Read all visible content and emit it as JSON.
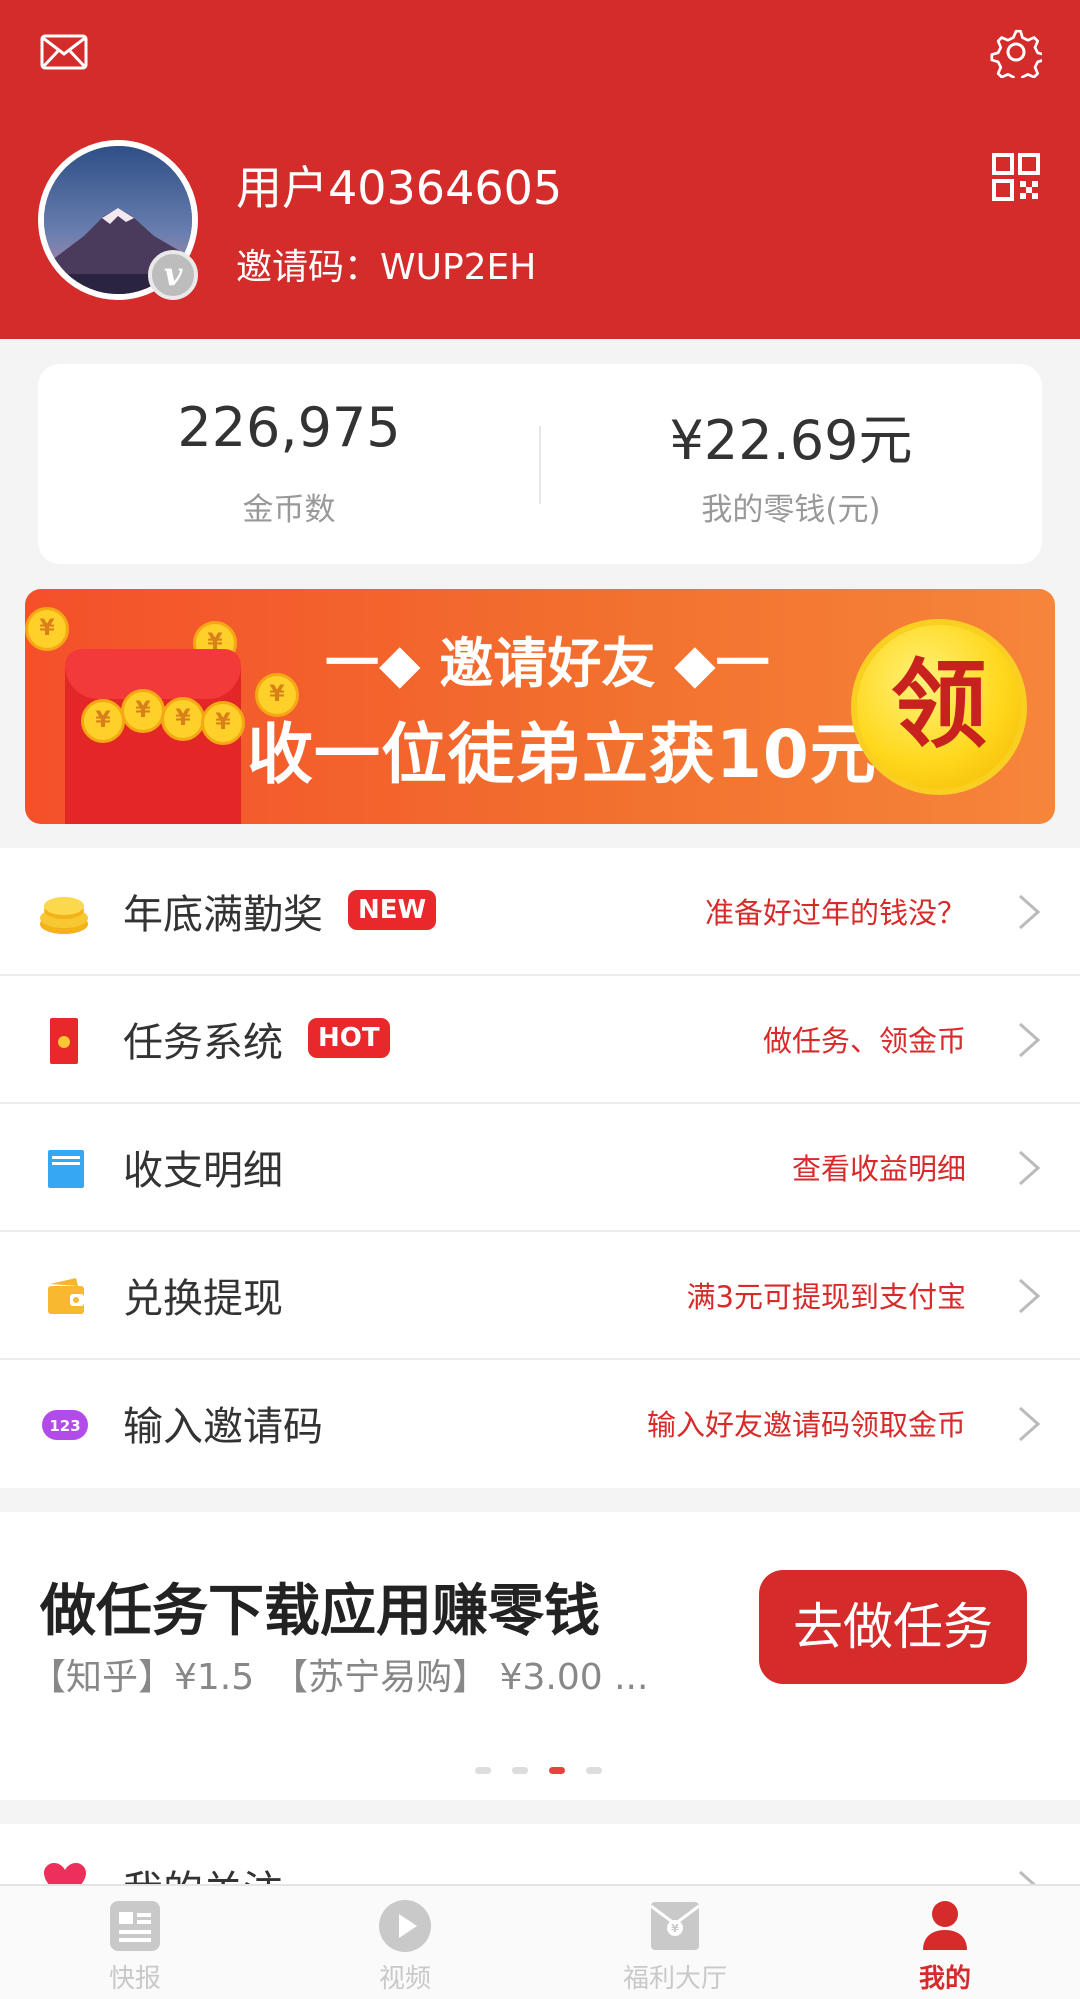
{
  "header": {
    "username": "用户40364605",
    "invite_code": "邀请码：WUP2EH",
    "icons": [
      "mail-icon",
      "settings-icon",
      "qr-code-icon"
    ],
    "avatar_badge": "v"
  },
  "stats": {
    "coins_value": "226,975",
    "coins_label": "金币数",
    "balance_value": "¥22.69元",
    "balance_label": "我的零钱(元)"
  },
  "banner": {
    "title": "一◆ 邀请好友 ◆一",
    "subtitle": "收一位徒弟立获10元",
    "claim": "领"
  },
  "menu": [
    {
      "label": "年底满勤奖",
      "tag": "NEW",
      "hint": "准备好过年的钱没？",
      "icon": "coins-icon"
    },
    {
      "label": "任务系统",
      "tag": "HOT",
      "hint": "做任务、领金币",
      "icon": "red-envelope-icon"
    },
    {
      "label": "收支明细",
      "tag": "",
      "hint": "查看收益明细",
      "icon": "ledger-icon"
    },
    {
      "label": "兑换提现",
      "tag": "",
      "hint": "满3元可提现到支付宝",
      "icon": "wallet-icon"
    },
    {
      "label": "输入邀请码",
      "tag": "",
      "hint": "输入好友邀请码领取金币",
      "icon": "number-123-icon"
    }
  ],
  "task_card": {
    "title": "做任务下载应用赚零钱",
    "subtitle": "【知乎】¥1.5　【苏宁易购】 ¥3.00  ...",
    "button": "去做任务",
    "carousel_active_index": 2,
    "carousel_count": 4
  },
  "follow": {
    "label": "我的关注",
    "icon": "heart-icon"
  },
  "tabbar": [
    {
      "label": "快报",
      "icon": "news-icon",
      "active": false
    },
    {
      "label": "视频",
      "icon": "play-icon",
      "active": false
    },
    {
      "label": "福利大厅",
      "icon": "gift-bag-icon",
      "active": false
    },
    {
      "label": "我的",
      "icon": "person-icon",
      "active": true
    }
  ],
  "colors": {
    "brand_red": "#d42b2b",
    "accent_red": "#e8282b",
    "text": "#333333",
    "muted": "#999999"
  }
}
